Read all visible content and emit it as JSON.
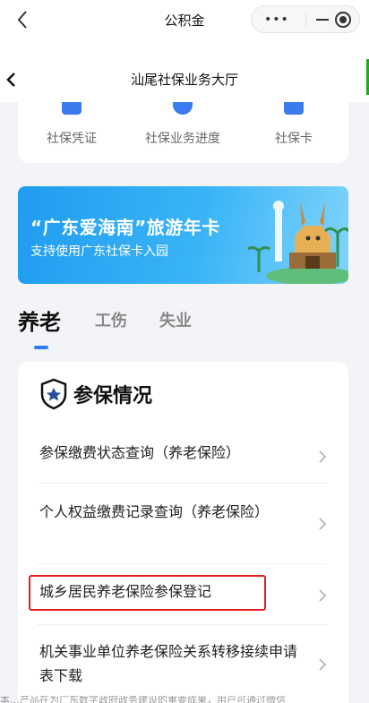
{
  "mini_program": {
    "title": "公积金",
    "more_label": "•••"
  },
  "nav": {
    "title": "汕尾社保业务大厅"
  },
  "quick_links": [
    {
      "label": "社保凭证",
      "icon": "document-icon"
    },
    {
      "label": "社保业务进度",
      "icon": "clock-icon"
    },
    {
      "label": "社保卡",
      "icon": "card-icon"
    }
  ],
  "banner": {
    "title": "“广东爱海南”旅游年卡",
    "subtitle": "支持使用广东社保卡入园"
  },
  "tabs": [
    {
      "label": "养老",
      "active": true
    },
    {
      "label": "工伤",
      "active": false
    },
    {
      "label": "失业",
      "active": false
    }
  ],
  "section": {
    "title": "参保情况",
    "items": [
      {
        "label": "参保缴费状态查询（养老保险）"
      },
      {
        "label": "个人权益缴费记录查询（养老保险）"
      },
      {
        "label": "城乡居民养老保险参保登记"
      },
      {
        "label": "机关事业单位养老保险关系转移接续申请表下载"
      }
    ]
  },
  "footer": {
    "text": "本…产品在为广东数字政府政务建设的重要成果，用户可通过微信"
  },
  "colors": {
    "accent": "#2f7cf6",
    "highlight": "#e02020",
    "banner": "#2aa6f3"
  }
}
